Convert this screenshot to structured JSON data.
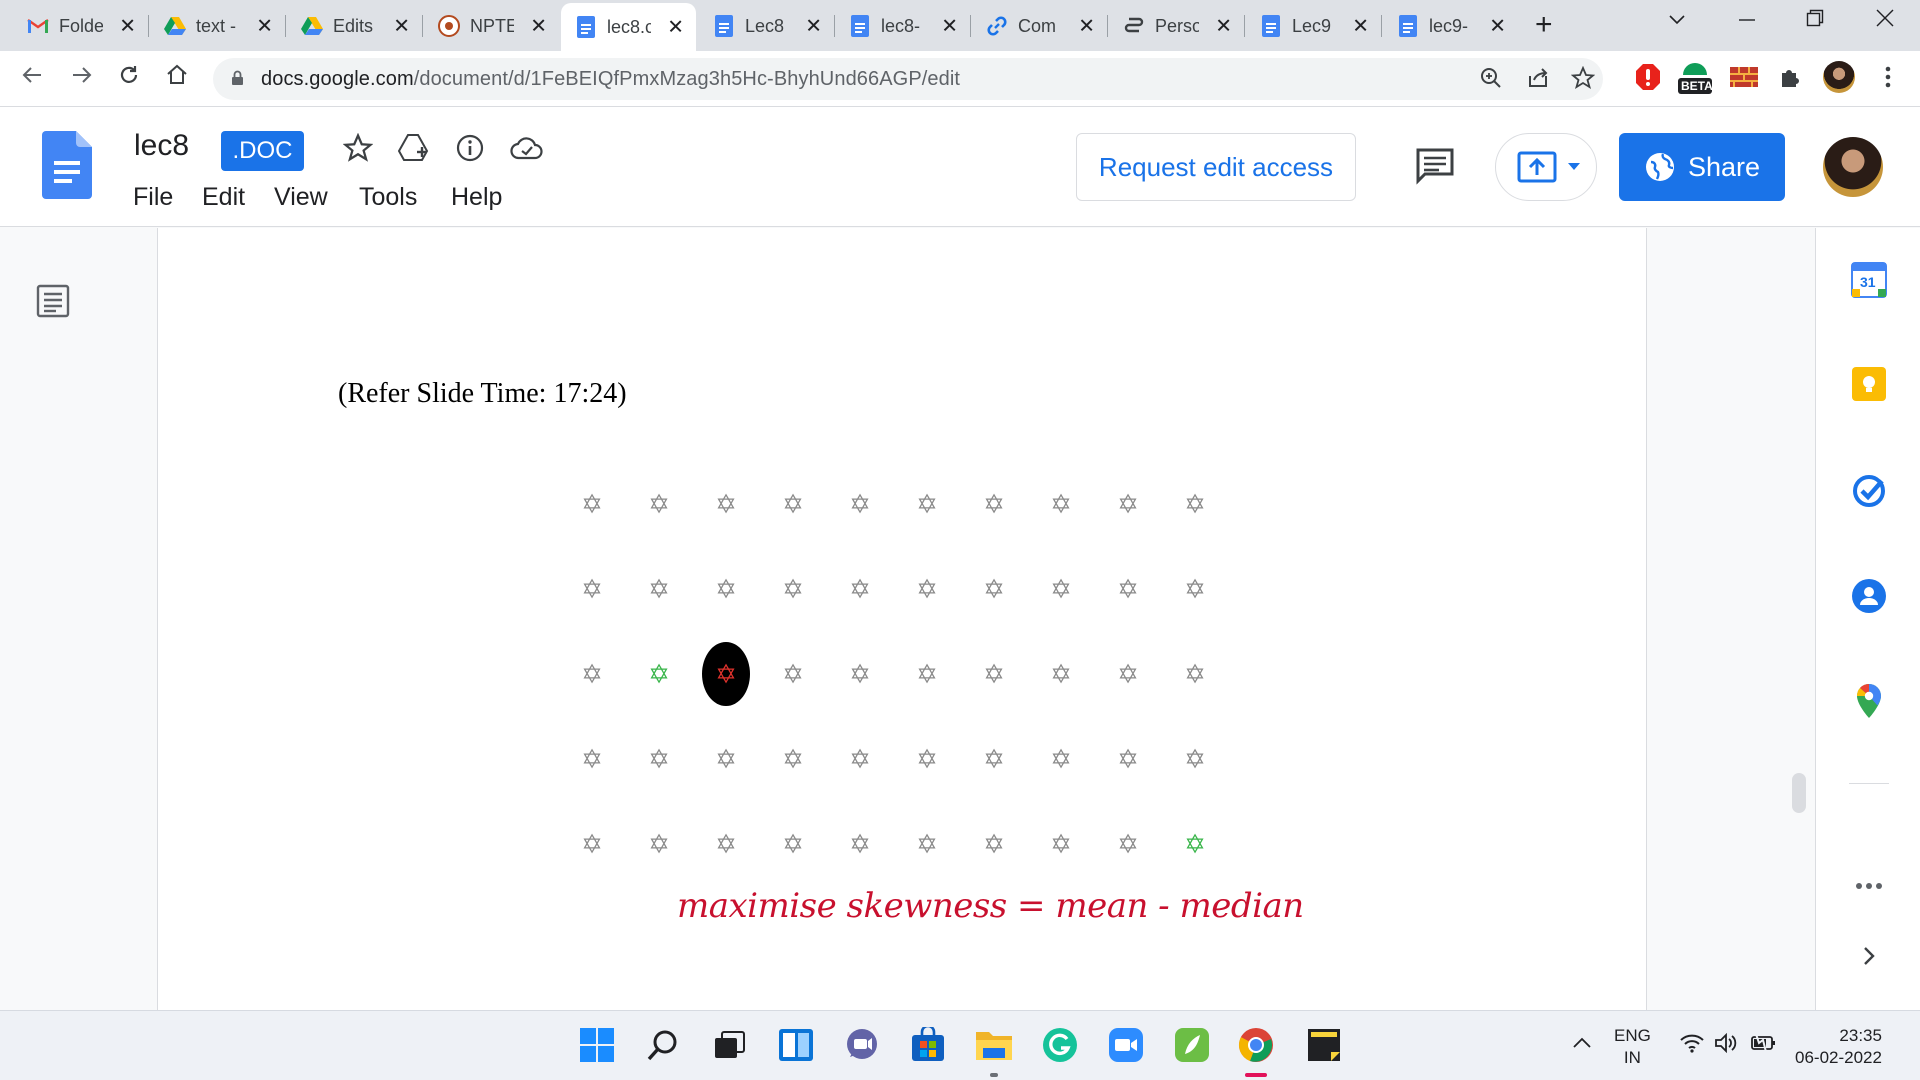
{
  "browser": {
    "tabs": [
      {
        "title": "Folde",
        "icon": "gmail-icon"
      },
      {
        "title": "text -",
        "icon": "drive-icon"
      },
      {
        "title": "Edits",
        "icon": "drive-icon"
      },
      {
        "title": "NPTE",
        "icon": "nptel-icon"
      },
      {
        "title": "lec8.c",
        "icon": "docs-icon",
        "active": true
      },
      {
        "title": "Lec8",
        "icon": "docs-icon"
      },
      {
        "title": "lec8-",
        "icon": "docs-icon"
      },
      {
        "title": "Com",
        "icon": "link-icon"
      },
      {
        "title": "Perso",
        "icon": "chain-icon"
      },
      {
        "title": "Lec9",
        "icon": "docs-icon"
      },
      {
        "title": "lec9-",
        "icon": "docs-icon"
      }
    ],
    "url_host": "docs.google.com",
    "url_path": "/document/d/1FeBEIQfPmxMzag3h5Hc-BhyhUnd66AGP/edit",
    "extension_badge": "BETA"
  },
  "docs": {
    "title": "lec8",
    "badge": ".DOC",
    "menu": [
      "File",
      "Edit",
      "View",
      "Tools",
      "Help"
    ],
    "request_edit_label": "Request edit access",
    "share_label": "Share"
  },
  "document": {
    "slide_time": "(Refer Slide Time: 17:24)",
    "formula": "maximise skewness = mean - median",
    "star_grid": {
      "rows": 5,
      "cols": 10,
      "green": [
        [
          2,
          1
        ],
        [
          4,
          9
        ]
      ],
      "highlight": [
        [
          2,
          2
        ]
      ]
    }
  },
  "side_panel": {
    "calendar_day": "31"
  },
  "taskbar": {
    "language": "ENG",
    "region": "IN",
    "time": "23:35",
    "date": "06-02-2022"
  },
  "colors": {
    "accent": "#1a73e8",
    "star_gray": "#8a8a8a",
    "star_green": "#39b54a",
    "formula_red": "#c8102e"
  }
}
